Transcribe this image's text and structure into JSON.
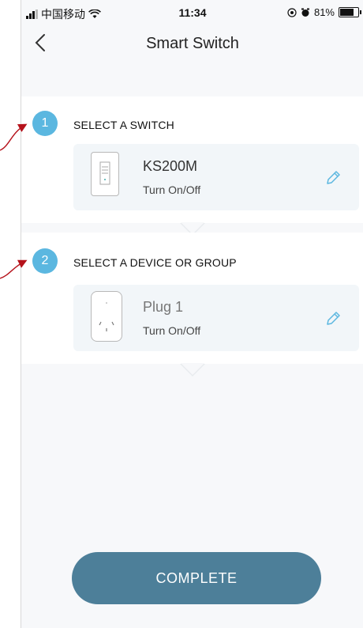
{
  "status_bar": {
    "carrier": "中国移动",
    "time": "11:34",
    "battery": "81%"
  },
  "nav": {
    "title": "Smart Switch"
  },
  "steps": [
    {
      "number": "1",
      "title": "SELECT A SWITCH",
      "device_name": "KS200M",
      "action": "Turn On/Off"
    },
    {
      "number": "2",
      "title": "SELECT A DEVICE OR GROUP",
      "device_name": "Plug 1",
      "action": "Turn On/Off"
    }
  ],
  "complete_label": "COMPLETE",
  "colors": {
    "accent": "#5bb7e0",
    "button": "#4d7f99",
    "annotation_arrow": "#b5121b"
  }
}
